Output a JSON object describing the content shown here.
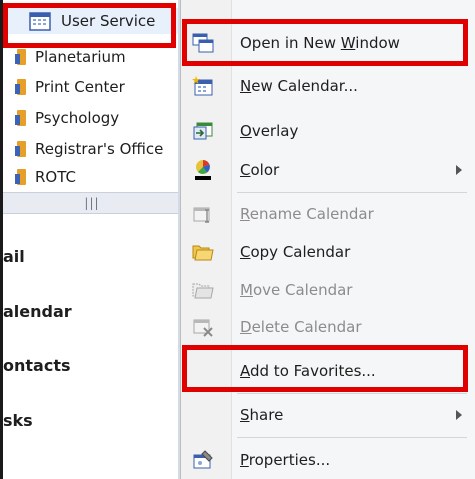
{
  "calendar_list": {
    "selected": "User Service",
    "items": [
      "Planetarium",
      "Print Center",
      "Psychology",
      "Registrar's Office",
      "ROTC"
    ]
  },
  "splitter_grip": "|||",
  "nav": [
    "ail",
    "alendar",
    "ontacts",
    "sks"
  ],
  "menu": {
    "items": [
      {
        "label_pre": "Open in New ",
        "ul": "W",
        "label_post": "indow",
        "icon": "new-window-icon"
      },
      {
        "label_pre": "",
        "ul": "N",
        "label_post": "ew Calendar...",
        "icon": "new-calendar-icon"
      },
      {
        "label_pre": "",
        "ul": "O",
        "label_post": "verlay",
        "icon": "overlay-icon"
      },
      {
        "label_pre": "",
        "ul": "C",
        "label_post": "olor",
        "icon": "color-icon"
      },
      {
        "label_pre": "",
        "ul": "R",
        "label_post": "ename Calendar",
        "icon": "rename-icon",
        "disabled": true
      },
      {
        "label_pre": "",
        "ul": "C",
        "label_post": "opy Calendar",
        "icon": "copy-calendar-icon"
      },
      {
        "label_pre": "",
        "ul": "M",
        "label_post": "ove Calendar",
        "icon": "move-calendar-icon",
        "disabled": true
      },
      {
        "label_pre": "",
        "ul": "D",
        "label_post": "elete Calendar",
        "icon": "delete-calendar-icon",
        "disabled": true
      },
      {
        "label_pre": "",
        "ul": "A",
        "label_post": "dd to Favorites...",
        "icon": ""
      },
      {
        "label_pre": "",
        "ul": "S",
        "label_post": "hare",
        "icon": ""
      },
      {
        "label_pre": "",
        "ul": "P",
        "label_post": "roperties...",
        "icon": "properties-icon"
      }
    ]
  },
  "highlight_color": "#e10000"
}
